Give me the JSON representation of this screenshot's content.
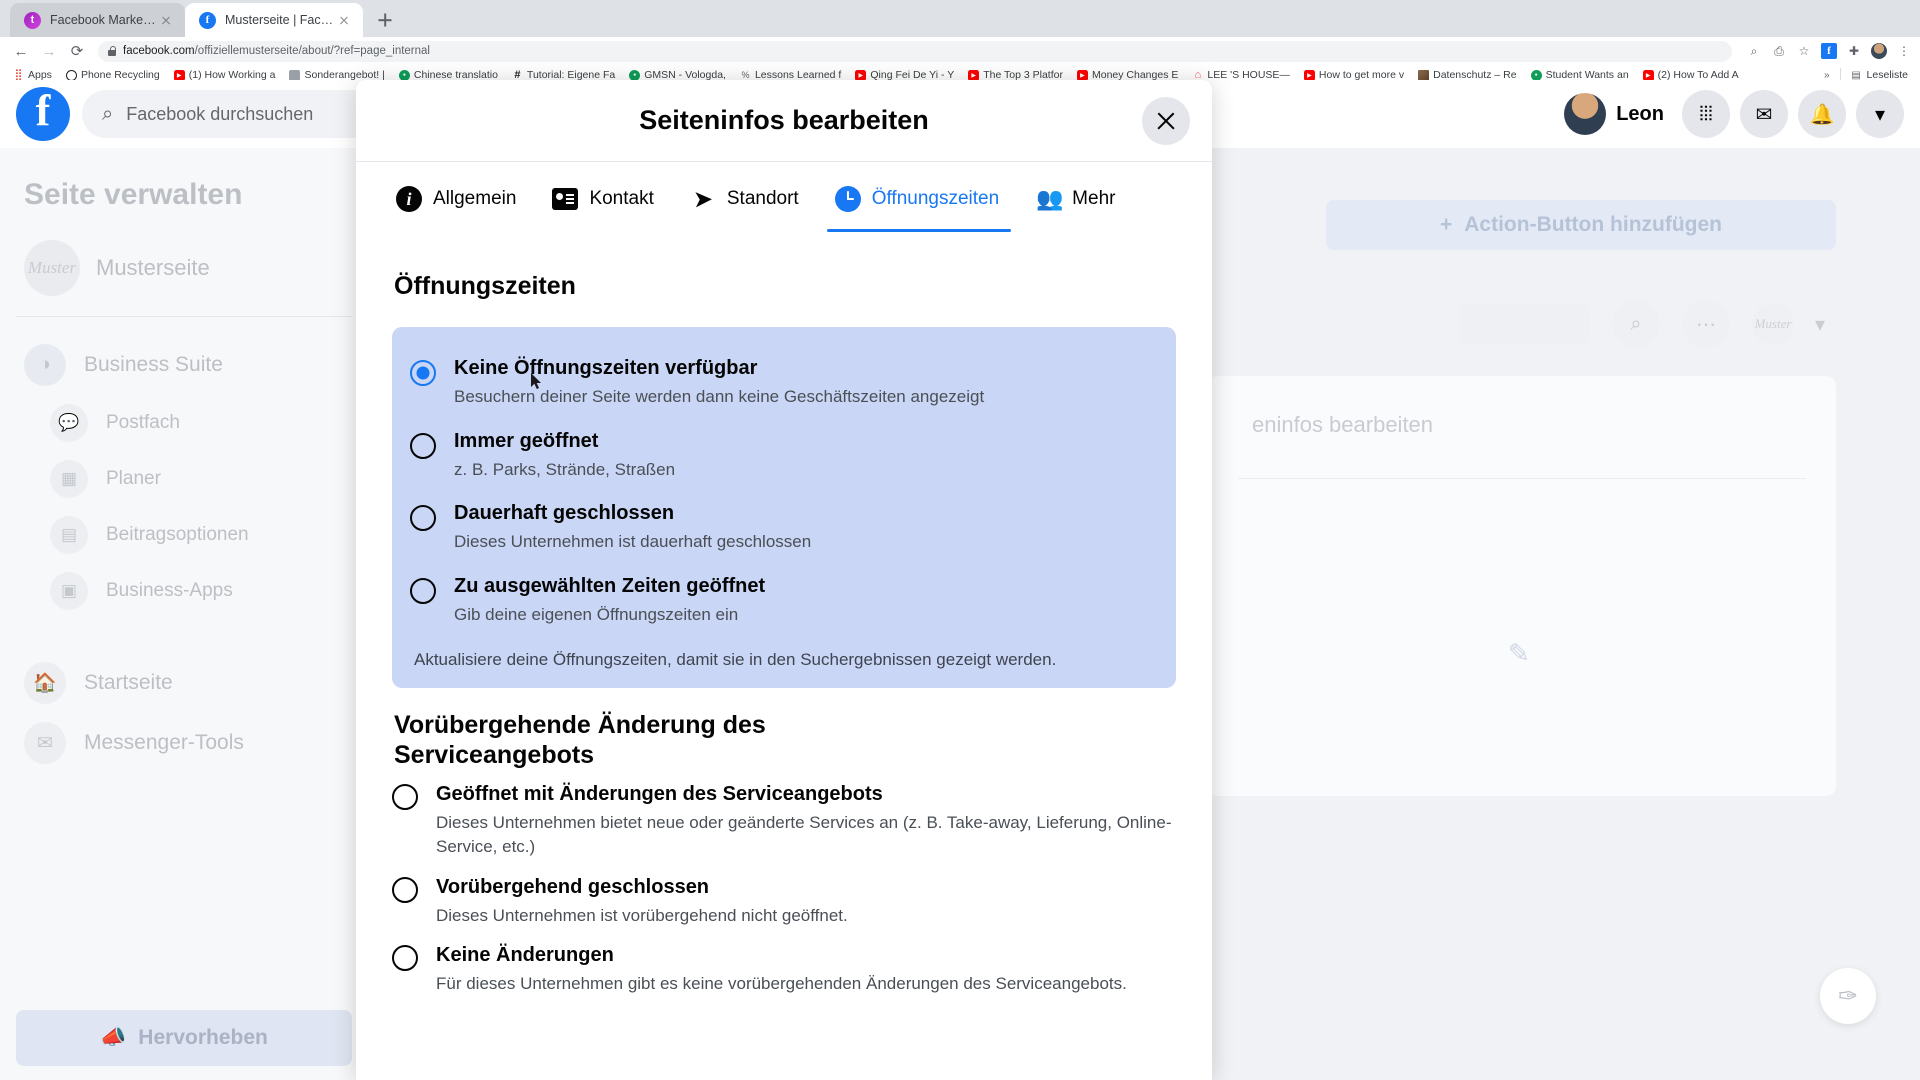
{
  "browser": {
    "tabs": [
      {
        "title": "Facebook Marketing & Werbea",
        "favicon": "purple-circle-icon",
        "active": false
      },
      {
        "title": "Musterseite | Facebook",
        "favicon": "facebook-icon",
        "active": true
      }
    ],
    "new_tab_label": "+",
    "url_domain": "facebook.com",
    "url_path": "/offiziellemusterseite/about/?ref=page_internal",
    "back_icon": "←",
    "forward_icon": "→",
    "reload_icon": "⟳",
    "toolbar_icons": [
      "zoom-icon",
      "install-icon",
      "star-icon",
      "facebook-extension-icon",
      "extensions-icon",
      "profile-avatar",
      "menu-icon"
    ],
    "bookmarks": [
      {
        "label": "Apps",
        "icon": "apps-grid-icon"
      },
      {
        "label": "Phone Recycling",
        "icon": "ring-icon"
      },
      {
        "label": "(1) How Working a",
        "icon": "youtube-icon"
      },
      {
        "label": "Sonderangebot! |",
        "icon": "grey-icon"
      },
      {
        "label": "Chinese translatio",
        "icon": "green-circle-icon"
      },
      {
        "label": "Tutorial: Eigene Fa",
        "icon": "hash-icon"
      },
      {
        "label": "GMSN - Vologda,",
        "icon": "green-circle-icon"
      },
      {
        "label": "Lessons Learned f",
        "icon": "percent-icon"
      },
      {
        "label": "Qing Fei De Yi - Y",
        "icon": "youtube-icon"
      },
      {
        "label": "The Top 3 Platfor",
        "icon": "youtube-icon"
      },
      {
        "label": "Money Changes E",
        "icon": "youtube-icon"
      },
      {
        "label": "LEE 'S HOUSE—",
        "icon": "airbnb-icon"
      },
      {
        "label": "How to get more v",
        "icon": "youtube-icon"
      },
      {
        "label": "Datenschutz – Re",
        "icon": "photo-icon"
      },
      {
        "label": "Student Wants an",
        "icon": "green-circle-icon"
      },
      {
        "label": "(2) How To Add A",
        "icon": "youtube-icon"
      }
    ],
    "bookmarks_overflow": "»",
    "reading_list": "Leseliste",
    "reading_list_icon": "reading-list-icon"
  },
  "facebook": {
    "logo": "f",
    "search_placeholder": "Facebook durchsuchen",
    "search_icon": "search-icon",
    "username": "Leon",
    "right_icons": [
      "grid-menu-icon",
      "messenger-icon",
      "notifications-icon",
      "account-chevron-icon"
    ],
    "sidebar": {
      "title": "Seite verwalten",
      "page_name": "Musterseite",
      "page_avatar_text": "Muster",
      "items": [
        {
          "label": "Business Suite",
          "icon": "business-suite-icon",
          "sub": false
        },
        {
          "label": "Postfach",
          "icon": "inbox-icon",
          "sub": true
        },
        {
          "label": "Planer",
          "icon": "planner-icon",
          "sub": true
        },
        {
          "label": "Beitragsoptionen",
          "icon": "post-options-icon",
          "sub": true
        },
        {
          "label": "Business-Apps",
          "icon": "business-apps-icon",
          "sub": true
        }
      ],
      "items2": [
        {
          "label": "Startseite",
          "icon": "home-icon"
        },
        {
          "label": "Messenger-Tools",
          "icon": "messenger-tools-icon"
        }
      ],
      "highlight_label": "Hervorheben",
      "highlight_icon": "megaphone-icon"
    },
    "main": {
      "action_button_label": "Action-Button hinzufügen",
      "action_button_icon": "plus-icon",
      "tool_search_icon": "search-icon",
      "tool_more_icon": "more-dots-icon",
      "tool_page_avatar": "Muster",
      "tool_page_chevron": "chevron-down-icon",
      "card_title": "eninfos bearbeiten",
      "edit_icon": "pencil-icon",
      "fab_icon": "compose-icon"
    }
  },
  "modal": {
    "title": "Seiteninfos bearbeiten",
    "close_icon": "close-icon",
    "tabs": [
      {
        "label": "Allgemein",
        "icon": "info-icon",
        "active": false
      },
      {
        "label": "Kontakt",
        "icon": "contact-card-icon",
        "active": false
      },
      {
        "label": "Standort",
        "icon": "location-arrow-icon",
        "active": false
      },
      {
        "label": "Öffnungszeiten",
        "icon": "clock-icon",
        "active": true
      },
      {
        "label": "Mehr",
        "icon": "people-icon",
        "active": false
      }
    ],
    "section_hours": {
      "heading": "Öffnungszeiten",
      "options": [
        {
          "title": "Keine Öffnungszeiten verfügbar",
          "subtitle": "Besuchern deiner Seite werden dann keine Geschäftszeiten angezeigt",
          "selected": true
        },
        {
          "title": "Immer geöffnet",
          "subtitle": "z. B. Parks, Strände, Straßen",
          "selected": false
        },
        {
          "title": "Dauerhaft geschlossen",
          "subtitle": "Dieses Unternehmen ist dauerhaft geschlossen",
          "selected": false
        },
        {
          "title": "Zu ausgewählten Zeiten geöffnet",
          "subtitle": "Gib deine eigenen Öffnungszeiten ein",
          "selected": false
        }
      ],
      "note": "Aktualisiere deine Öffnungszeiten, damit sie in den Suchergebnissen gezeigt werden."
    },
    "section_service": {
      "heading": "Vorübergehende Änderung des Serviceangebots",
      "options": [
        {
          "title": "Geöffnet mit Änderungen des Serviceangebots",
          "subtitle": "Dieses Unternehmen bietet neue oder geänderte Services an (z. B. Take-away, Lieferung, Online-Service, etc.)",
          "selected": false
        },
        {
          "title": "Vorübergehend geschlossen",
          "subtitle": "Dieses Unternehmen ist vorübergehend nicht geöffnet.",
          "selected": false
        },
        {
          "title": "Keine Änderungen",
          "subtitle": "Für dieses Unternehmen gibt es keine vorübergehenden Änderungen des Serviceangebots.",
          "selected": false
        }
      ]
    }
  },
  "colors": {
    "accent_blue": "#1877f2",
    "panel_blue": "#c9d6f5",
    "chrome_grey": "#dee1e6",
    "page_grey": "#f0f2f5"
  }
}
